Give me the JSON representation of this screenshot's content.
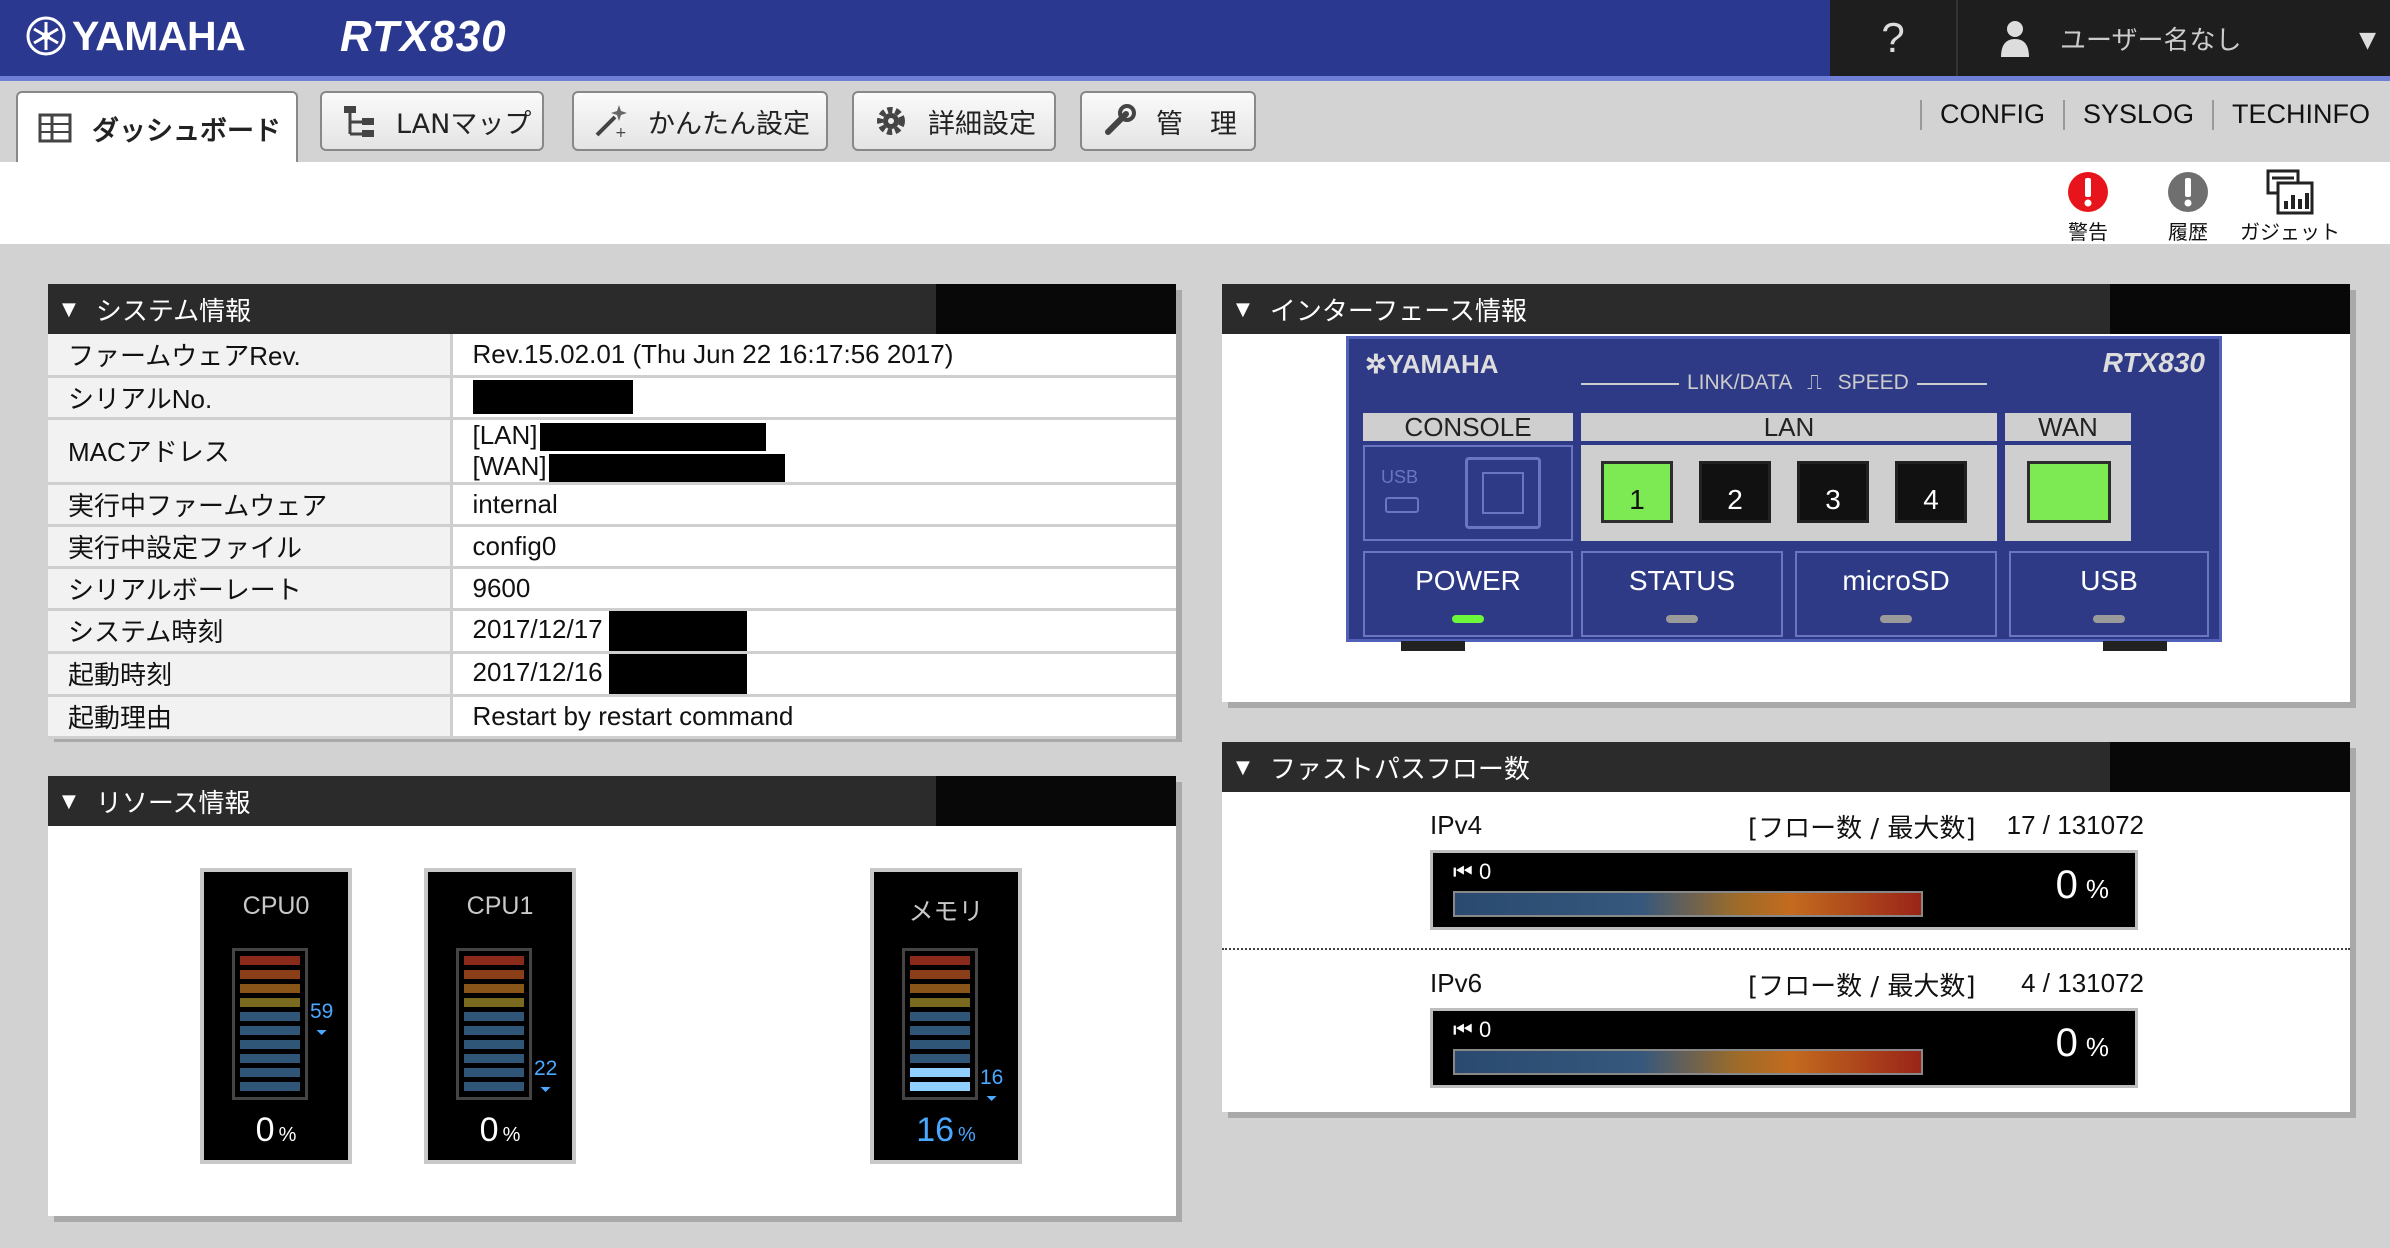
{
  "header": {
    "brand": "YAMAHA",
    "model": "RTX830",
    "help_label": "?",
    "user_label": "ユーザー名なし"
  },
  "nav": {
    "tabs": [
      {
        "label": "ダッシュボード",
        "icon": "dashboard-icon"
      },
      {
        "label": "LANマップ",
        "icon": "lan-map-icon"
      },
      {
        "label": "かんたん設定",
        "icon": "wand-icon"
      },
      {
        "label": "詳細設定",
        "icon": "gear-icon"
      },
      {
        "label": "管　理",
        "icon": "wrench-icon"
      }
    ],
    "links": [
      "CONFIG",
      "SYSLOG",
      "TECHINFO"
    ]
  },
  "tools": [
    {
      "label": "警告",
      "icon": "alert-red-icon"
    },
    {
      "label": "履歴",
      "icon": "history-icon"
    },
    {
      "label": "ガジェット",
      "icon": "gadget-icon"
    }
  ],
  "system_info": {
    "title": "システム情報",
    "rows": [
      {
        "label": "ファームウェアRev.",
        "value": "Rev.15.02.01 (Thu Jun 22 16:17:56 2017)"
      },
      {
        "label": "シリアルNo.",
        "value": ""
      },
      {
        "label": "MACアドレス",
        "value": "[LAN]",
        "value2": "[WAN]"
      },
      {
        "label": "実行中ファームウェア",
        "value": "internal"
      },
      {
        "label": "実行中設定ファイル",
        "value": "config0"
      },
      {
        "label": "シリアルボーレート",
        "value": "9600"
      },
      {
        "label": "システム時刻",
        "value": "2017/12/17"
      },
      {
        "label": "起動時刻",
        "value": "2017/12/16"
      },
      {
        "label": "起動理由",
        "value": "Restart by restart command"
      }
    ]
  },
  "resource_info": {
    "title": "リソース情報",
    "meters": [
      {
        "label": "CPU0",
        "value": "0",
        "unit": "%",
        "peak": "59",
        "level": 0.0,
        "peak_level": 0.59
      },
      {
        "label": "CPU1",
        "value": "0",
        "unit": "%",
        "peak": "22",
        "level": 0.0,
        "peak_level": 0.22
      },
      {
        "label": "メモリ",
        "value": "16",
        "unit": "%",
        "peak": "16",
        "level": 0.16,
        "peak_level": 0.16
      }
    ]
  },
  "interface_info": {
    "title": "インターフェース情報",
    "brand": "YAMAHA",
    "model": "RTX830",
    "legend": "LINK/DATA",
    "speed": "SPEED",
    "groups": {
      "console": "CONSOLE",
      "lan": "LAN",
      "wan": "WAN"
    },
    "usb_small": "USB",
    "lan_ports": [
      {
        "label": "1",
        "active": true
      },
      {
        "label": "2",
        "active": false
      },
      {
        "label": "3",
        "active": false
      },
      {
        "label": "4",
        "active": false
      }
    ],
    "wan_active": true,
    "status_cells": [
      {
        "label": "POWER",
        "on": true
      },
      {
        "label": "STATUS",
        "on": false
      },
      {
        "label": "microSD",
        "on": false
      },
      {
        "label": "USB",
        "on": false
      }
    ]
  },
  "fastpath": {
    "title": "ファストパスフロー数",
    "rows": [
      {
        "name": "IPv4",
        "caption": "[フロー数 / 最大数]",
        "value": "17 / 131072",
        "min": "0",
        "percent": "0",
        "unit": "%"
      },
      {
        "name": "IPv6",
        "caption": "[フロー数 / 最大数]",
        "value": "4 / 131072",
        "min": "0",
        "percent": "0",
        "unit": "%"
      }
    ]
  },
  "colors": {
    "header_bg": "#2a3890",
    "accent": "#6f7fd6",
    "led_green": "#6cf73a",
    "alert_red": "#e8141c",
    "meter_blue": "#4aa8ff"
  }
}
